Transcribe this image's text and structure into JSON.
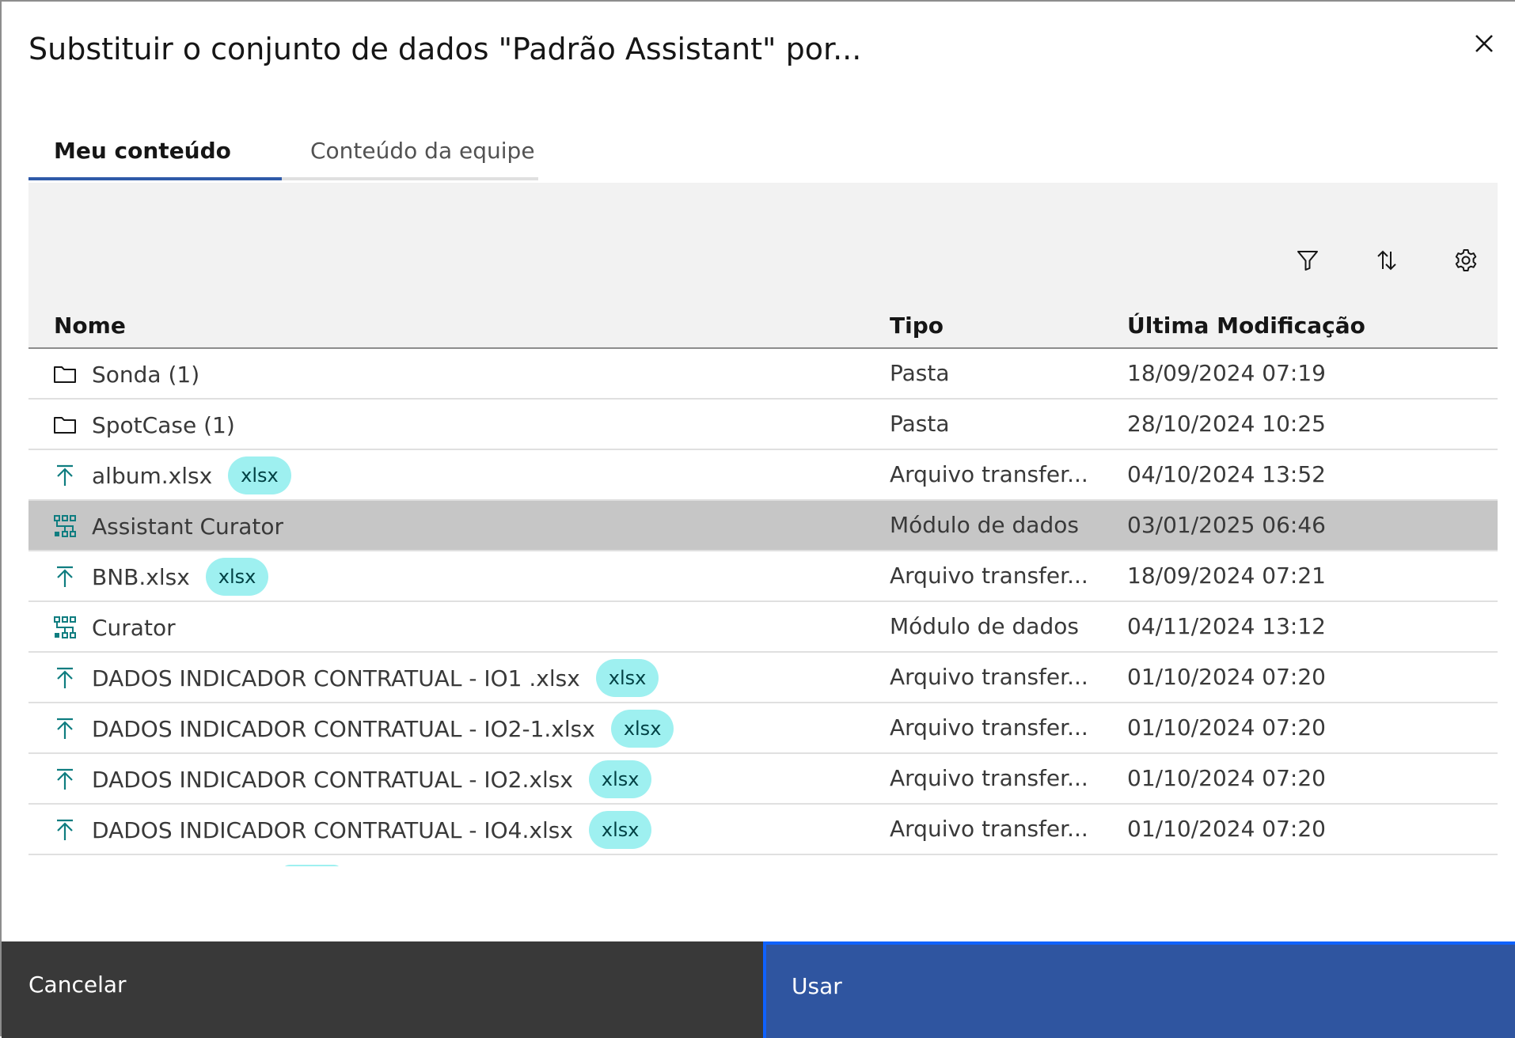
{
  "dialog": {
    "title": "Substituir o conjunto de dados \"Padrão Assistant\" por...",
    "close_icon": "close-icon"
  },
  "tabs": [
    {
      "label": "Meu conteúdo",
      "active": true
    },
    {
      "label": "Conteúdo da equipe",
      "active": false
    }
  ],
  "toolbar": {
    "icons": [
      "filter-icon",
      "sort-icon",
      "settings-icon"
    ]
  },
  "table": {
    "headers": {
      "name": "Nome",
      "type": "Tipo",
      "modified": "Última Modificação"
    },
    "rows": [
      {
        "icon": "folder-icon",
        "name": "Sonda (1)",
        "tag": "",
        "type": "Pasta",
        "modified": "18/09/2024 07:19",
        "selected": false
      },
      {
        "icon": "folder-icon",
        "name": "SpotCase (1)",
        "tag": "",
        "type": "Pasta",
        "modified": "28/10/2024 10:25",
        "selected": false
      },
      {
        "icon": "upload-icon",
        "name": "album.xlsx",
        "tag": "xlsx",
        "type": "Arquivo transfer...",
        "modified": "04/10/2024 13:52",
        "selected": false
      },
      {
        "icon": "data-module-icon",
        "name": "Assistant Curator",
        "tag": "",
        "type": "Módulo de dados",
        "modified": "03/01/2025 06:46",
        "selected": true
      },
      {
        "icon": "upload-icon",
        "name": "BNB.xlsx",
        "tag": "xlsx",
        "type": "Arquivo transfer...",
        "modified": "18/09/2024 07:21",
        "selected": false
      },
      {
        "icon": "data-module-icon",
        "name": "Curator",
        "tag": "",
        "type": "Módulo de dados",
        "modified": "04/11/2024 13:12",
        "selected": false
      },
      {
        "icon": "upload-icon",
        "name": "DADOS INDICADOR CONTRATUAL - IO1 .xlsx",
        "tag": "xlsx",
        "type": "Arquivo transfer...",
        "modified": "01/10/2024 07:20",
        "selected": false
      },
      {
        "icon": "upload-icon",
        "name": "DADOS INDICADOR CONTRATUAL - IO2-1.xlsx",
        "tag": "xlsx",
        "type": "Arquivo transfer...",
        "modified": "01/10/2024 07:20",
        "selected": false
      },
      {
        "icon": "upload-icon",
        "name": "DADOS INDICADOR CONTRATUAL - IO2.xlsx",
        "tag": "xlsx",
        "type": "Arquivo transfer...",
        "modified": "01/10/2024 07:20",
        "selected": false
      },
      {
        "icon": "upload-icon",
        "name": "DADOS INDICADOR CONTRATUAL - IO4.xlsx",
        "tag": "xlsx",
        "type": "Arquivo transfer...",
        "modified": "01/10/2024 07:20",
        "selected": false
      }
    ]
  },
  "footer": {
    "cancel_label": "Cancelar",
    "use_label": "Usar"
  },
  "colors": {
    "primary": "#2f55a0",
    "tab_active": "#2f5aa8",
    "secondary_button": "#393939",
    "tag_bg": "#9ef0f0",
    "icon_teal": "#0f7d80",
    "row_selected": "#c6c6c6"
  }
}
